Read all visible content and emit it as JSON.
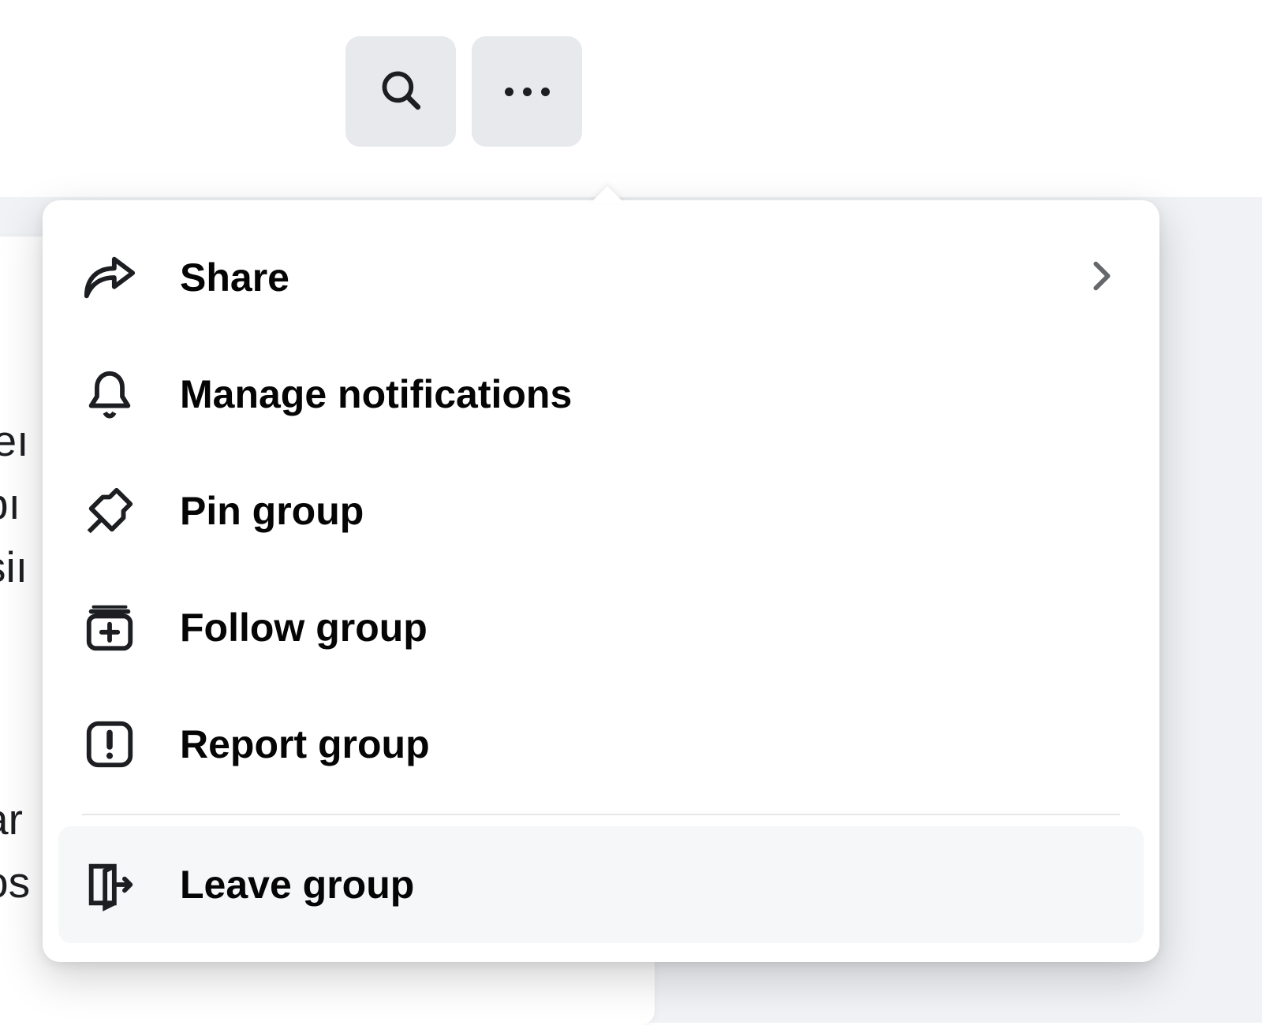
{
  "toolbar": {
    "search_button": "Search",
    "more_button": "More options"
  },
  "background_text": {
    "block1": "'eı\nbı\nsiı",
    "block2": "ar\nos"
  },
  "menu": {
    "items": [
      {
        "id": "share",
        "label": "Share",
        "icon": "share-arrow-icon",
        "has_chevron": true
      },
      {
        "id": "manage-notifications",
        "label": "Manage notifications",
        "icon": "bell-icon",
        "has_chevron": false
      },
      {
        "id": "pin-group",
        "label": "Pin group",
        "icon": "pushpin-icon",
        "has_chevron": false
      },
      {
        "id": "follow-group",
        "label": "Follow group",
        "icon": "follow-plus-icon",
        "has_chevron": false
      },
      {
        "id": "report-group",
        "label": "Report group",
        "icon": "alert-square-icon",
        "has_chevron": false
      }
    ],
    "after_divider": [
      {
        "id": "leave-group",
        "label": "Leave group",
        "icon": "leave-door-icon",
        "has_chevron": false,
        "highlight": true
      }
    ]
  }
}
